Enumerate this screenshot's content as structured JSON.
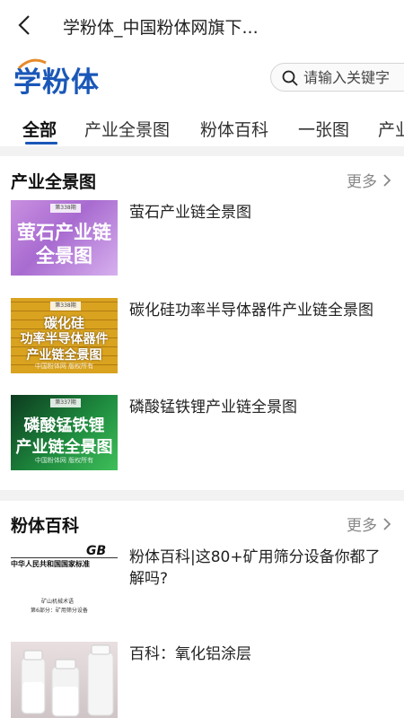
{
  "header": {
    "title": "学粉体_中国粉体网旗下..."
  },
  "brand": {
    "logo_text": "学粉体"
  },
  "search": {
    "placeholder": "请输入关键字"
  },
  "tabs": [
    "全部",
    "产业全景图",
    "粉体百科",
    "一张图",
    "产业"
  ],
  "sections": [
    {
      "title": "产业全景图",
      "more_label": "更多",
      "items": [
        {
          "title": "萤石产业链全景图",
          "thumb_text": [
            "萤石产业链",
            "全景图"
          ],
          "issue": "第338期"
        },
        {
          "title": "碳化硅功率半导体器件产业链全景图",
          "thumb_text": [
            "碳化硅",
            "功率半导体器件",
            "产业链全景图"
          ],
          "issue": "第338期",
          "thumb_sub": "中国粉体网 版权所有"
        },
        {
          "title": "磷酸锰铁锂产业链全景图",
          "thumb_text": [
            "磷酸锰铁锂",
            "产业链全景图"
          ],
          "issue": "第337期",
          "thumb_sub": "中国粉体网 版权所有"
        }
      ]
    },
    {
      "title": "粉体百科",
      "more_label": "更多",
      "items": [
        {
          "title": "粉体百科|这80+矿用筛分设备你都了解吗?",
          "thumb_text": [
            "中华人民共和国国家标准",
            "矿山机械术语",
            "第6部分：矿用筛分设备"
          ],
          "thumb_logo": "GB"
        },
        {
          "title": "百科：氧化铝涂层"
        }
      ]
    }
  ],
  "colors": {
    "brand_blue": "#1a57b8",
    "section_gap": "#f2f2f2",
    "muted": "#888888"
  }
}
